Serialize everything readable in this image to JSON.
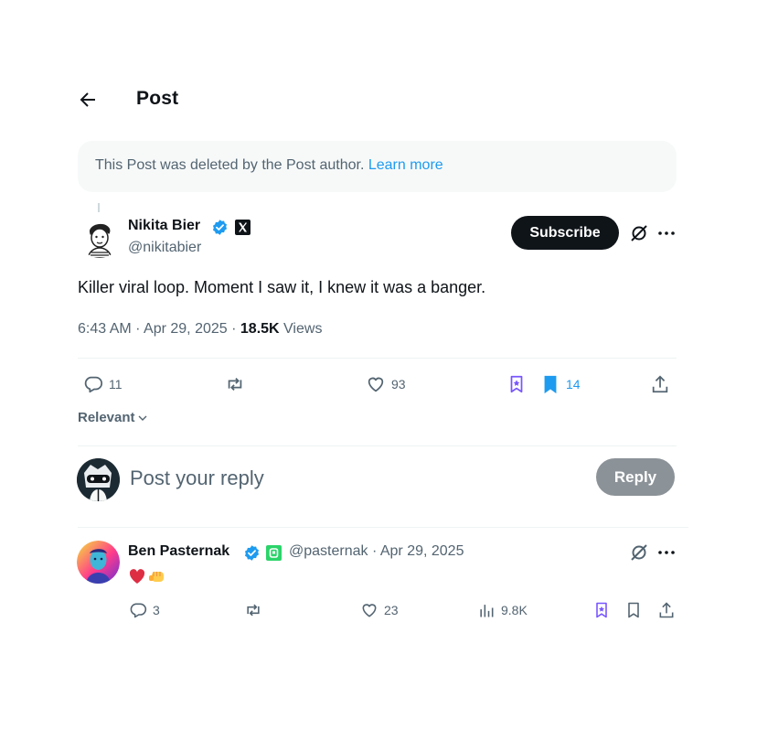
{
  "header": {
    "title": "Post",
    "back_icon": "arrow-left-icon"
  },
  "notice": {
    "text": "This Post was deleted by the Post author.",
    "link": "Learn more"
  },
  "post": {
    "author_name": "Nikita Bier",
    "handle": "@nikitabier",
    "subscribe_label": "Subscribe",
    "text": "Killer viral loop. Moment I saw it, I knew it was a banger.",
    "time": "6:43 AM · Apr 29, 2025 · ",
    "views_count": "18.5K",
    "views_label": "Views",
    "replies": "11",
    "likes": "93",
    "bookmarks": "14"
  },
  "sort": {
    "label": "Relevant"
  },
  "composer": {
    "placeholder": "Post your reply",
    "reply_label": "Reply"
  },
  "reply": {
    "author_name": "Ben Pasternak",
    "handle_date": "@pasternak · Apr 29, 2025",
    "emojis": "❤️👊",
    "replies": "3",
    "likes": "23",
    "views": "9.8K"
  },
  "colors": {
    "accent": "#1d9bf0",
    "verified": "#1d9bf0",
    "grok_purple": "#7856ff",
    "reply_disabled": "#8b9298"
  }
}
